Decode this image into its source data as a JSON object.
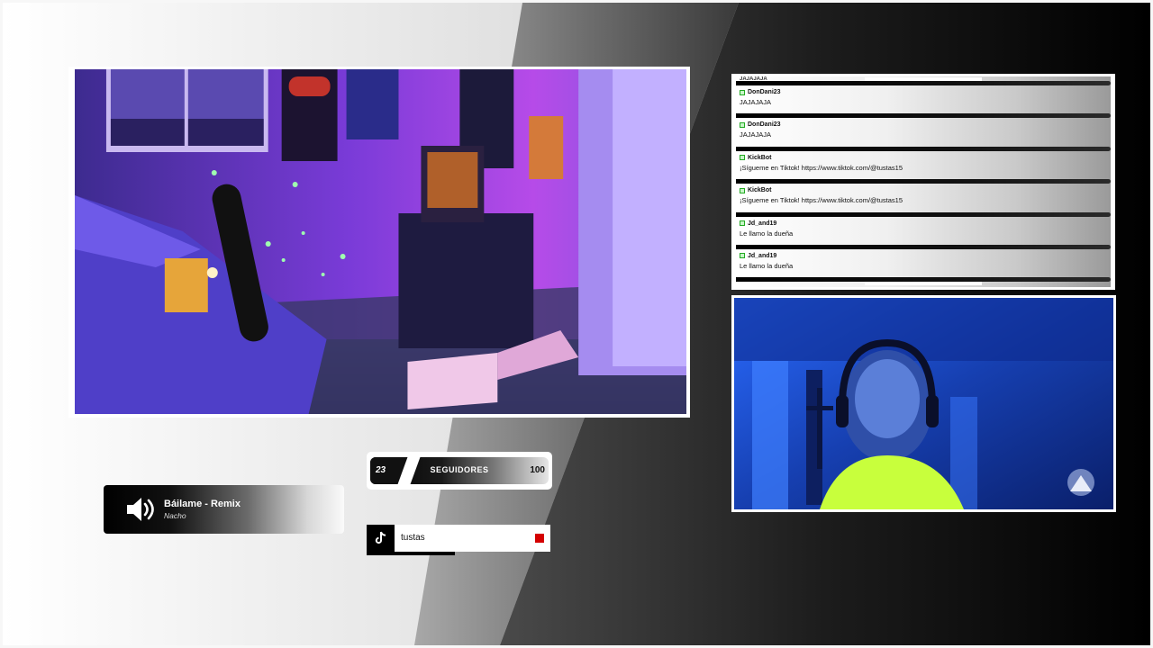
{
  "chat": {
    "top_cut_text": "JAJAJAJA",
    "messages": [
      {
        "user": "DonDani23",
        "text": "JAJAJAJA"
      },
      {
        "user": "DonDani23",
        "text": "JAJAJAJA"
      },
      {
        "user": "KickBot",
        "text": "¡Sígueme en Tiktok! https://www.tiktok.com/@tustas15"
      },
      {
        "user": "KickBot",
        "text": "¡Sígueme en Tiktok! https://www.tiktok.com/@tustas15"
      },
      {
        "user": "Jd_and19",
        "text": "Le llamo la dueña"
      },
      {
        "user": "Jd_and19",
        "text": "Le llamo la dueña"
      }
    ]
  },
  "now_playing": {
    "title": "Báilame - Remix",
    "artist": "Nacho",
    "icon": "speaker-icon"
  },
  "goal": {
    "current": "23",
    "label": "SEGUIDORES",
    "target": "100",
    "progress": 0.23
  },
  "tiktok": {
    "username": "tustas",
    "icon": "tiktok-icon",
    "live_color": "#d40000"
  },
  "colors": {
    "accent": "#000000",
    "scene_purple": "#6a2fd1",
    "cam_blue": "#1a4fd8",
    "shirt": "#c8ff3c"
  }
}
